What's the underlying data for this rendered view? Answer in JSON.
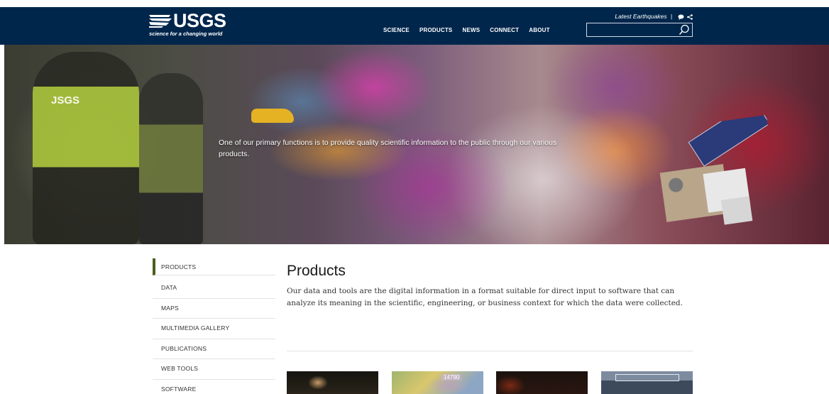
{
  "header": {
    "logo_text": "USGS",
    "logo_tagline": "science for a changing world",
    "nav": [
      {
        "label": "SCIENCE"
      },
      {
        "label": "PRODUCTS"
      },
      {
        "label": "NEWS"
      },
      {
        "label": "CONNECT"
      },
      {
        "label": "ABOUT"
      }
    ],
    "latest_quakes_label": "Latest Earthquakes",
    "separator": "|",
    "search_placeholder": "",
    "search_icon": "search-icon"
  },
  "hero": {
    "text": "One of our primary functions is to provide quality scientific information to the public through our various products.",
    "badge": "JSGS"
  },
  "sidebar": {
    "items": [
      {
        "label": "PRODUCTS",
        "active": true
      },
      {
        "label": "DATA"
      },
      {
        "label": "MAPS"
      },
      {
        "label": "MULTIMEDIA GALLERY"
      },
      {
        "label": "PUBLICATIONS"
      },
      {
        "label": "WEB TOOLS"
      },
      {
        "label": "SOFTWARE"
      }
    ]
  },
  "main": {
    "title": "Products",
    "description": "Our data and tools are the digital information in a format suitable for direct input to software that can analyze its meaning in the scientific, engineering, or business context for which the data were collected."
  },
  "cards": {
    "card2_tag": "14790"
  },
  "colors": {
    "header_bg": "#00264c",
    "active_marker": "#4a5e1e"
  }
}
